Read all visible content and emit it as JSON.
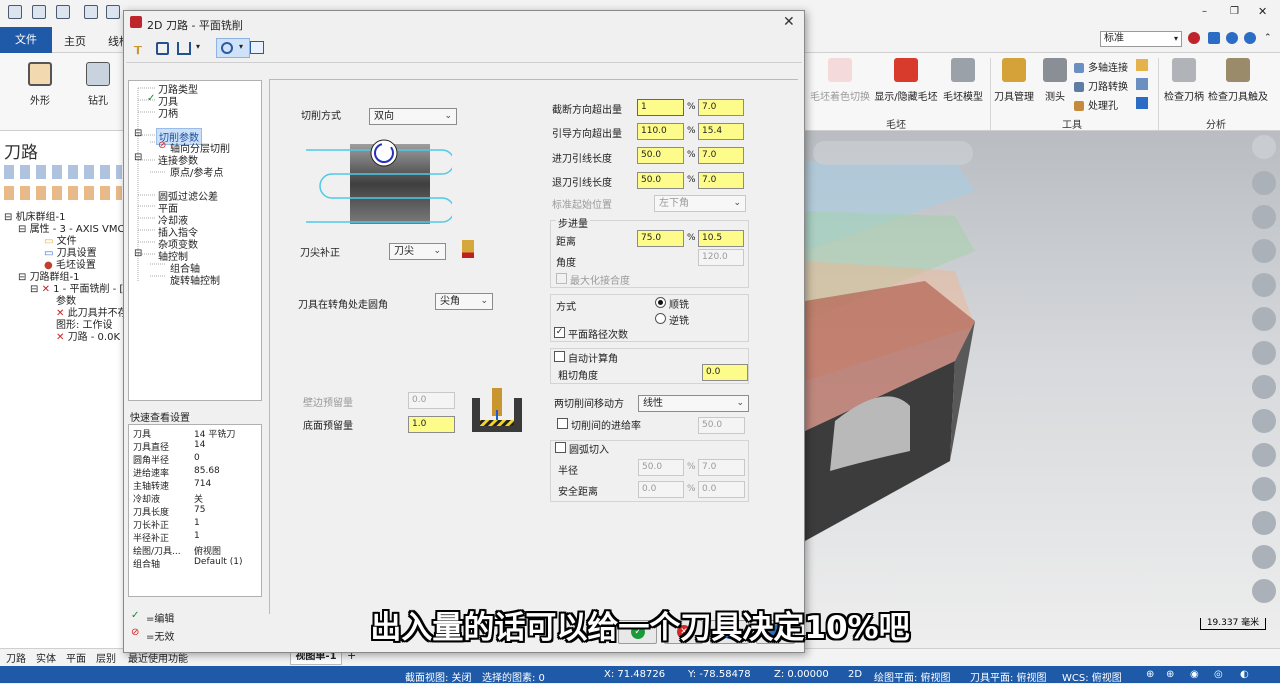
{
  "app": {
    "file_tab": "文件",
    "tabs": [
      "主页",
      "线框"
    ],
    "style_select": "标准"
  },
  "ribbon": {
    "left_buttons": [
      "外形",
      "钻孔"
    ],
    "stock_group": {
      "buttons": [
        "毛坯着色切换",
        "显示/隐藏毛坯",
        "毛坯模型"
      ],
      "label": "毛坯"
    },
    "tools_group": {
      "buttons": [
        "刀具管理",
        "测头"
      ],
      "small": [
        "多轴连接",
        "刀路转换",
        "处理孔"
      ],
      "label": "工具"
    },
    "analysis_group": {
      "buttons": [
        "检查刀柄",
        "检查刀具触及"
      ],
      "label": "分析"
    }
  },
  "manager": {
    "title": "刀路",
    "tree": [
      "机床群组-1",
      "属性 - 3 - AXIS VMC",
      "文件",
      "刀具设置",
      "毛坯设置",
      "刀路群组-1",
      "1 - 平面铣削 - [V",
      "参数",
      "此刀具并不存",
      "图形: 工作设",
      "刀路 - 0.0K -"
    ]
  },
  "dialog": {
    "title": "2D 刀路 - 平面铣削",
    "close": "✕",
    "tree": {
      "items": [
        "刀路类型",
        "刀具",
        "刀柄",
        "切削参数",
        "轴向分层切削",
        "连接参数",
        "原点/参考点",
        "圆弧过滤公差",
        "平面",
        "冷却液",
        "插入指令",
        "杂项变数",
        "轴控制",
        "组合轴",
        "旋转轴控制"
      ]
    },
    "quick_view": {
      "title": "快速查看设置",
      "rows": [
        {
          "k": "刀具",
          "v": "14 平铣刀"
        },
        {
          "k": "刀具直径",
          "v": "14"
        },
        {
          "k": "圆角半径",
          "v": "0"
        },
        {
          "k": "进给速率",
          "v": "85.68"
        },
        {
          "k": "主轴转速",
          "v": "714"
        },
        {
          "k": "冷却液",
          "v": "关"
        },
        {
          "k": "刀具长度",
          "v": "75"
        },
        {
          "k": "刀长补正",
          "v": "1"
        },
        {
          "k": "半径补正",
          "v": "1"
        },
        {
          "k": "绘图/刀具...",
          "v": "俯视图"
        },
        {
          "k": "组合轴",
          "v": "Default (1)"
        }
      ]
    },
    "legend": {
      "edit": "=编辑",
      "invalid": "=无效"
    },
    "params": {
      "cut_method_label": "切削方式",
      "cut_method_value": "双向",
      "tip_comp_label": "刀尖补正",
      "tip_comp_value": "刀尖",
      "corner_label": "刀具在转角处走圆角",
      "corner_value": "尖角",
      "wall_stock_label": "壁边预留量",
      "wall_stock_value": "0.0",
      "floor_stock_label": "底面预留量",
      "floor_stock_value": "1.0",
      "rows": [
        {
          "label": "截断方向超出量",
          "pct": "1",
          "val": "7.0"
        },
        {
          "label": "引导方向超出量",
          "pct": "110.0",
          "val": "15.4"
        },
        {
          "label": "进刀引线长度",
          "pct": "50.0",
          "val": "7.0"
        },
        {
          "label": "退刀引线长度",
          "pct": "50.0",
          "val": "7.0"
        }
      ],
      "start_pos_label": "标准起始位置",
      "start_pos_value": "左下角",
      "stepover": {
        "title": "步进量",
        "dist_label": "距离",
        "dist_pct": "75.0",
        "dist_val": "10.5",
        "angle_label": "角度",
        "angle_val": "120.0",
        "max_overlap": "最大化接合度"
      },
      "direction": {
        "label": "方式",
        "climb": "顺铣",
        "conventional": "逆铣",
        "plane_passes": "平面路径次数"
      },
      "auto_calc": "自动计算角",
      "rough_angle_label": "粗切角度",
      "rough_angle_val": "0.0",
      "move_between_label": "两切削间移动方",
      "move_between_value": "线性",
      "feed_between_label": "切削间的进给率",
      "feed_between_val": "50.0",
      "arc_entry": "圆弧切入",
      "radius_label": "半径",
      "radius_pct": "50.0",
      "radius_val": "7.0",
      "safe_label": "安全距离",
      "safe_pct": "0.0",
      "safe_val": "0.0",
      "pct_sign": "%"
    }
  },
  "viewport": {
    "scale": "19.337 毫米"
  },
  "bottom_tabs": [
    "刀路",
    "实体",
    "平面",
    "层别",
    "最近使用功能"
  ],
  "view_sheet": "视图单-1",
  "status": {
    "section": "截面视图: 关闭",
    "selected": "选择的图素: 0",
    "x": "X: 71.48726",
    "y": "Y: -78.58478",
    "z": "Z: 0.00000",
    "mode": "2D",
    "draw_plane": "绘图平面: 俯视图",
    "tool_plane": "刀具平面: 俯视图",
    "wcs": "WCS: 俯视图"
  },
  "subtitle": "出入量的话可以给一个刀具决定10%吧",
  "colors": {
    "accent": "#1e5aa8",
    "field_yellow": "#fdfc8a"
  }
}
